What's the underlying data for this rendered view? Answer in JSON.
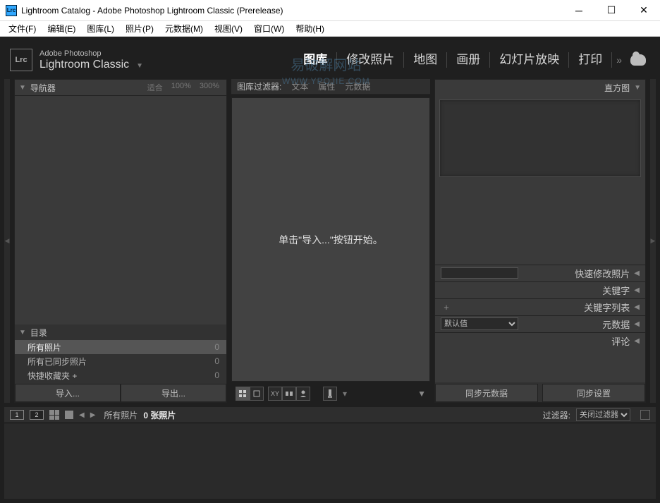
{
  "window": {
    "title": "Lightroom Catalog - Adobe Photoshop Lightroom Classic (Prerelease)",
    "badge": "Lrc"
  },
  "menubar": [
    "文件(F)",
    "编辑(E)",
    "图库(L)",
    "照片(P)",
    "元数据(M)",
    "视图(V)",
    "窗口(W)",
    "帮助(H)"
  ],
  "branding": {
    "line1": "Adobe Photoshop",
    "line2": "Lightroom Classic"
  },
  "modules": [
    "图库",
    "修改照片",
    "地图",
    "画册",
    "幻灯片放映",
    "打印"
  ],
  "active_module": "图库",
  "watermark": {
    "line1": "易破解网站",
    "line2": "WWW.YPOJIE.COM"
  },
  "left_panel": {
    "navigator": {
      "title": "导航器",
      "fit": "适合",
      "zoom1": "100%",
      "zoom2": "300%"
    },
    "catalog": {
      "title": "目录",
      "items": [
        {
          "label": "所有照片",
          "count": "0",
          "selected": true
        },
        {
          "label": "所有已同步照片",
          "count": "0",
          "selected": false
        },
        {
          "label": "快捷收藏夹 +",
          "count": "0",
          "selected": false
        }
      ]
    },
    "import_btn": "导入...",
    "export_btn": "导出..."
  },
  "center_panel": {
    "filter_label": "图库过滤器:",
    "filter_opts": [
      "文本",
      "属性",
      "元数据"
    ],
    "placeholder": "单击\"导入...\"按钮开始。"
  },
  "right_panel": {
    "histogram": "直方图",
    "sections": {
      "quick": "快速修改照片",
      "keywords": "关键字",
      "keyword_list": "关键字列表",
      "metadata": "元数据",
      "metadata_preset": "默认值",
      "comments": "评论"
    },
    "sync_meta_btn": "同步元数据",
    "sync_settings_btn": "同步设置"
  },
  "filmstrip": {
    "monitor1": "1",
    "monitor2": "2",
    "breadcrumb": "所有照片",
    "count_text": "0 张照片",
    "filter_label": "过滤器:",
    "filter_select": "关闭过滤器"
  }
}
